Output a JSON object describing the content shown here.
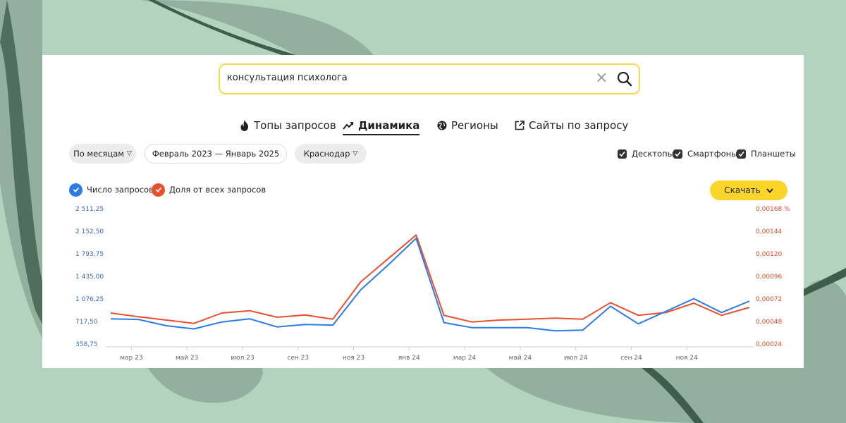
{
  "search": {
    "query": "консультация психолога"
  },
  "tabs": [
    {
      "label": "Топы запросов",
      "icon": "fire-icon"
    },
    {
      "label": "Динамика",
      "icon": "trend-icon",
      "active": true
    },
    {
      "label": "Регионы",
      "icon": "globe-icon"
    },
    {
      "label": "Сайты по запросу",
      "icon": "external-link-icon"
    }
  ],
  "filters": {
    "period_group": "По месяцам",
    "date_range": "Февраль 2023 — Январь 2025",
    "region": "Краснодар"
  },
  "devices": [
    {
      "label": "Десктопы",
      "checked": true
    },
    {
      "label": "Смартфоны",
      "checked": true
    },
    {
      "label": "Планшеты",
      "checked": true
    }
  ],
  "legend": {
    "count": "Число запросов",
    "share": "Доля от всех запросов"
  },
  "download_label": "Скачать",
  "colors": {
    "count": "#2e7be6",
    "share": "#e8502e",
    "accent": "#fbd52a",
    "background": "#b3d3bf"
  },
  "chart_data": {
    "type": "line",
    "x": [
      "фев 23",
      "мар 23",
      "апр 23",
      "май 23",
      "июн 23",
      "июл 23",
      "авг 23",
      "сен 23",
      "окт 23",
      "ноя 23",
      "дек 23",
      "янв 24",
      "фев 24",
      "мар 24",
      "апр 24",
      "май 24",
      "июн 24",
      "июл 24",
      "авг 24",
      "сен 24",
      "окт 24",
      "ноя 24",
      "дек 24",
      "янв 25"
    ],
    "x_tick_labels": [
      "мар 23",
      "май 23",
      "июл 23",
      "сен 23",
      "ноя 23",
      "янв 24",
      "мар 24",
      "май 24",
      "июл 24",
      "сен 24",
      "ноя 24"
    ],
    "y_left_ticks": [
      "2 511,25",
      "2 152,50",
      "1 793,75",
      "1 435,00",
      "1 076,25",
      "717,50",
      "358,75"
    ],
    "y_right_ticks": [
      "0,00168 %",
      "0,00144",
      "0,00120",
      "0,00096",
      "0,00072",
      "0,00048",
      "0,00024"
    ],
    "ylim_left": [
      358.75,
      2511.25
    ],
    "ylim_right": [
      0.00024,
      0.00168
    ],
    "series": [
      {
        "name": "Число запросов",
        "axis": "left",
        "values": [
          760,
          750,
          650,
          600,
          710,
          760,
          630,
          670,
          660,
          1220,
          1620,
          2040,
          700,
          620,
          620,
          620,
          570,
          580,
          960,
          680,
          880,
          1080,
          860,
          1040
        ]
      },
      {
        "name": "Доля от всех запросов",
        "axis": "right",
        "values": [
          0.00057,
          0.00053,
          0.000495,
          0.00046,
          0.00057,
          0.000595,
          0.000525,
          0.00055,
          0.000505,
          0.0009,
          0.00115,
          0.0014,
          0.000545,
          0.000475,
          0.000495,
          0.000505,
          0.000515,
          0.000505,
          0.00068,
          0.000545,
          0.000575,
          0.000675,
          0.000545,
          0.00063
        ]
      }
    ]
  }
}
